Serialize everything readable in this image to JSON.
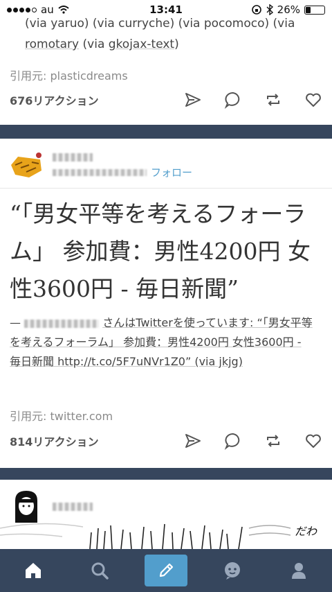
{
  "status_bar": {
    "carrier": "au",
    "time": "13:41",
    "battery": "26%",
    "battery_level": 0.26
  },
  "post1": {
    "trail_line1": "(via yaruo) (via curryche) (via pocomoco) (via",
    "trail_link1": "romotary",
    "trail_mid": " (via ",
    "trail_link2": "gkojax-text",
    "trail_end": ")",
    "source": "引用元: plasticdreams",
    "notes": "676リアクション"
  },
  "post2": {
    "follow": "フォロー",
    "quote": "“「男女平等を考えるフォーラム」 参加費：男性4200円 女性3600円 - 毎日新聞”",
    "caption_prefix": "—",
    "caption_text": "さんはTwitterを使っています: “「男女平等を考えるフォーラム」 参加費：男性4200円 女性3600円 - 毎日新聞 http://t.co/5F7uNVr1Z0” (via jkjg)",
    "source": "引用元: twitter.com",
    "notes": "814リアクション"
  },
  "post3": {
    "caption_fragment": "だわ"
  },
  "tabbar": {
    "icons": [
      "home-icon",
      "search-icon",
      "compose-icon",
      "activity-icon",
      "account-icon"
    ],
    "accent": "#529ecc",
    "background": "#36465d"
  }
}
